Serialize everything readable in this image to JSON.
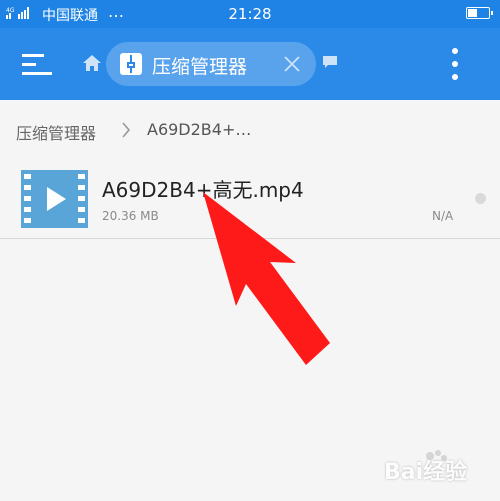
{
  "status_bar": {
    "carrier": "中国联通",
    "overflow": "…",
    "time": "21:28"
  },
  "toolbar": {
    "tab_label": "压缩管理器"
  },
  "breadcrumb": {
    "root": "压缩管理器",
    "current": "A69D2B4+…"
  },
  "file": {
    "name": "A69D2B4+高无.mp4",
    "size": "20.36 MB",
    "date": "N/A",
    "icon": "video-file-icon"
  },
  "colors": {
    "toolbar": "#2b8ae8",
    "status_bar": "#1e83e4",
    "annotation_arrow": "#ff1a1a"
  },
  "watermark": {
    "text": "Bai经验"
  }
}
